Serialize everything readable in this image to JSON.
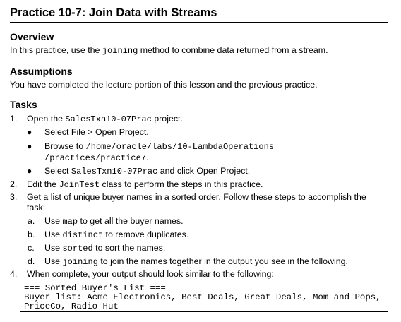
{
  "title": "Practice 10-7: Join Data with Streams",
  "overview": {
    "heading": "Overview",
    "text_before": "In this practice, use the ",
    "code": "joining",
    "text_after": " method to combine data returned from a stream."
  },
  "assumptions": {
    "heading": "Assumptions",
    "text": "You have completed the lecture portion of this lesson and the previous practice."
  },
  "tasks": {
    "heading": "Tasks",
    "step1": {
      "num": "1.",
      "text_before": "Open the ",
      "code": "SalesTxn10-07Prac",
      "text_after": " project.",
      "bullets": {
        "b1": "Select File > Open Project.",
        "b2_before": "Browse to ",
        "b2_code_line1": "/home/oracle/labs/10-LambdaOperations",
        "b2_code_line2": "/practices/practice7",
        "b2_after": ".",
        "b3_before": "Select ",
        "b3_code": "SalesTxn10-07Prac",
        "b3_after": " and click Open Project."
      }
    },
    "step2": {
      "num": "2.",
      "text_before": "Edit the ",
      "code": "JoinTest",
      "text_after": " class to perform the steps in this practice."
    },
    "step3": {
      "num": "3.",
      "line1": "Get a list of unique buyer names in a sorted order. Follow these steps to accomplish the",
      "line2": "task:",
      "subs": {
        "a": {
          "letter": "a.",
          "before": "Use ",
          "code": "map",
          "after": " to get all the buyer names."
        },
        "b": {
          "letter": "b.",
          "before": "Use ",
          "code": "distinct",
          "after": " to remove duplicates."
        },
        "c": {
          "letter": "c.",
          "before": "Use ",
          "code": "sorted",
          "after": " to sort the names."
        },
        "d": {
          "letter": "d.",
          "before": "Use ",
          "code": "joining",
          "after": " to join the names together in the output you see in the following."
        }
      }
    },
    "step4": {
      "num": "4.",
      "text": "When complete, your output should look similar to the following:"
    }
  },
  "output": {
    "line1": "=== Sorted Buyer's List ===",
    "line2": "Buyer list: Acme Electronics, Best Deals, Great Deals, Mom and Pops,",
    "line3": "PriceCo, Radio Hut"
  }
}
